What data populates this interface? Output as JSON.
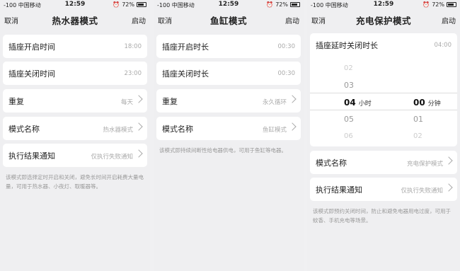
{
  "status": {
    "signal_carrier": "-100 中国移动",
    "time": "12:59",
    "battery": "72%"
  },
  "screens": [
    {
      "cancel": "取消",
      "title": "热水器模式",
      "start": "启动",
      "rows": [
        {
          "label": "插座开启时间",
          "value": "18:00"
        },
        {
          "label": "插座关闭时间",
          "value": "23:00"
        },
        {
          "label": "重复",
          "value": "每天"
        },
        {
          "label": "模式名称",
          "value": "热水器模式"
        },
        {
          "label": "执行结果通知",
          "value": "仅执行失败通知"
        }
      ],
      "description": "该模式即选择定时开启和关闭，避免长时间开启耗费大量电量，可用于热水器、小夜灯、取暖器等。"
    },
    {
      "cancel": "取消",
      "title": "鱼缸模式",
      "start": "启动",
      "rows": [
        {
          "label": "插座开启时长",
          "value": "00:30"
        },
        {
          "label": "插座关闭时长",
          "value": "00:30"
        },
        {
          "label": "重复",
          "value": "永久循环"
        },
        {
          "label": "模式名称",
          "value": "鱼缸模式"
        }
      ],
      "description": "该模式即持续间断性给电器供电，可用于鱼缸等电器。"
    },
    {
      "cancel": "取消",
      "title": "充电保护模式",
      "start": "启动",
      "picker": {
        "label": "插座延时关闭时长",
        "value": "04:00",
        "hours": [
          "02",
          "03",
          "04",
          "05",
          "06"
        ],
        "hour_unit": "小时",
        "minutes": [
          "",
          "",
          "00",
          "01",
          "02"
        ],
        "minute_unit": "分钟"
      },
      "rows": [
        {
          "label": "模式名称",
          "value": "充电保护模式"
        },
        {
          "label": "执行结果通知",
          "value": "仅执行失败通知"
        }
      ],
      "description": "该模式即预约关闭时间，防止和避免电器用电过度，可用于蚊香、手机充电等场景。"
    }
  ]
}
